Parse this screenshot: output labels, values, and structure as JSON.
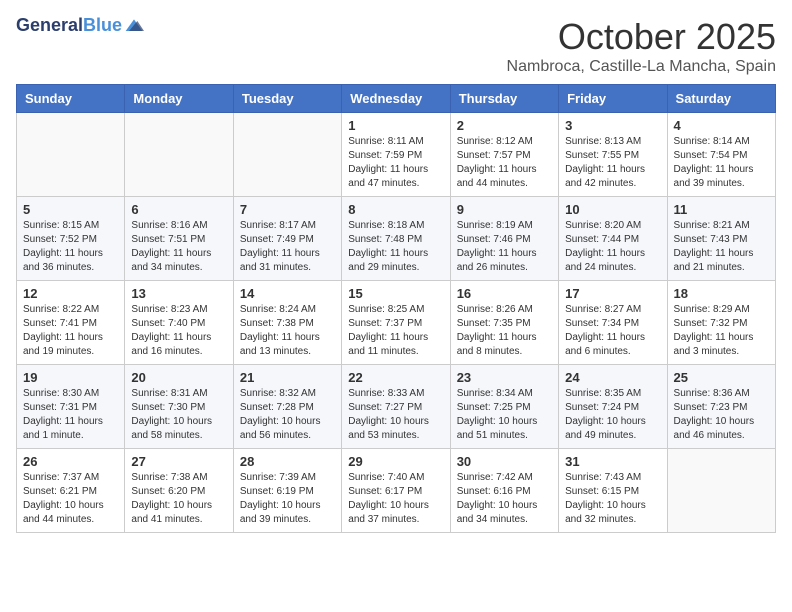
{
  "header": {
    "logo_line1": "General",
    "logo_line2": "Blue",
    "month": "October 2025",
    "location": "Nambroca, Castille-La Mancha, Spain"
  },
  "columns": [
    "Sunday",
    "Monday",
    "Tuesday",
    "Wednesday",
    "Thursday",
    "Friday",
    "Saturday"
  ],
  "weeks": [
    [
      {
        "day": "",
        "info": ""
      },
      {
        "day": "",
        "info": ""
      },
      {
        "day": "",
        "info": ""
      },
      {
        "day": "1",
        "info": "Sunrise: 8:11 AM\nSunset: 7:59 PM\nDaylight: 11 hours and 47 minutes."
      },
      {
        "day": "2",
        "info": "Sunrise: 8:12 AM\nSunset: 7:57 PM\nDaylight: 11 hours and 44 minutes."
      },
      {
        "day": "3",
        "info": "Sunrise: 8:13 AM\nSunset: 7:55 PM\nDaylight: 11 hours and 42 minutes."
      },
      {
        "day": "4",
        "info": "Sunrise: 8:14 AM\nSunset: 7:54 PM\nDaylight: 11 hours and 39 minutes."
      }
    ],
    [
      {
        "day": "5",
        "info": "Sunrise: 8:15 AM\nSunset: 7:52 PM\nDaylight: 11 hours and 36 minutes."
      },
      {
        "day": "6",
        "info": "Sunrise: 8:16 AM\nSunset: 7:51 PM\nDaylight: 11 hours and 34 minutes."
      },
      {
        "day": "7",
        "info": "Sunrise: 8:17 AM\nSunset: 7:49 PM\nDaylight: 11 hours and 31 minutes."
      },
      {
        "day": "8",
        "info": "Sunrise: 8:18 AM\nSunset: 7:48 PM\nDaylight: 11 hours and 29 minutes."
      },
      {
        "day": "9",
        "info": "Sunrise: 8:19 AM\nSunset: 7:46 PM\nDaylight: 11 hours and 26 minutes."
      },
      {
        "day": "10",
        "info": "Sunrise: 8:20 AM\nSunset: 7:44 PM\nDaylight: 11 hours and 24 minutes."
      },
      {
        "day": "11",
        "info": "Sunrise: 8:21 AM\nSunset: 7:43 PM\nDaylight: 11 hours and 21 minutes."
      }
    ],
    [
      {
        "day": "12",
        "info": "Sunrise: 8:22 AM\nSunset: 7:41 PM\nDaylight: 11 hours and 19 minutes."
      },
      {
        "day": "13",
        "info": "Sunrise: 8:23 AM\nSunset: 7:40 PM\nDaylight: 11 hours and 16 minutes."
      },
      {
        "day": "14",
        "info": "Sunrise: 8:24 AM\nSunset: 7:38 PM\nDaylight: 11 hours and 13 minutes."
      },
      {
        "day": "15",
        "info": "Sunrise: 8:25 AM\nSunset: 7:37 PM\nDaylight: 11 hours and 11 minutes."
      },
      {
        "day": "16",
        "info": "Sunrise: 8:26 AM\nSunset: 7:35 PM\nDaylight: 11 hours and 8 minutes."
      },
      {
        "day": "17",
        "info": "Sunrise: 8:27 AM\nSunset: 7:34 PM\nDaylight: 11 hours and 6 minutes."
      },
      {
        "day": "18",
        "info": "Sunrise: 8:29 AM\nSunset: 7:32 PM\nDaylight: 11 hours and 3 minutes."
      }
    ],
    [
      {
        "day": "19",
        "info": "Sunrise: 8:30 AM\nSunset: 7:31 PM\nDaylight: 11 hours and 1 minute."
      },
      {
        "day": "20",
        "info": "Sunrise: 8:31 AM\nSunset: 7:30 PM\nDaylight: 10 hours and 58 minutes."
      },
      {
        "day": "21",
        "info": "Sunrise: 8:32 AM\nSunset: 7:28 PM\nDaylight: 10 hours and 56 minutes."
      },
      {
        "day": "22",
        "info": "Sunrise: 8:33 AM\nSunset: 7:27 PM\nDaylight: 10 hours and 53 minutes."
      },
      {
        "day": "23",
        "info": "Sunrise: 8:34 AM\nSunset: 7:25 PM\nDaylight: 10 hours and 51 minutes."
      },
      {
        "day": "24",
        "info": "Sunrise: 8:35 AM\nSunset: 7:24 PM\nDaylight: 10 hours and 49 minutes."
      },
      {
        "day": "25",
        "info": "Sunrise: 8:36 AM\nSunset: 7:23 PM\nDaylight: 10 hours and 46 minutes."
      }
    ],
    [
      {
        "day": "26",
        "info": "Sunrise: 7:37 AM\nSunset: 6:21 PM\nDaylight: 10 hours and 44 minutes."
      },
      {
        "day": "27",
        "info": "Sunrise: 7:38 AM\nSunset: 6:20 PM\nDaylight: 10 hours and 41 minutes."
      },
      {
        "day": "28",
        "info": "Sunrise: 7:39 AM\nSunset: 6:19 PM\nDaylight: 10 hours and 39 minutes."
      },
      {
        "day": "29",
        "info": "Sunrise: 7:40 AM\nSunset: 6:17 PM\nDaylight: 10 hours and 37 minutes."
      },
      {
        "day": "30",
        "info": "Sunrise: 7:42 AM\nSunset: 6:16 PM\nDaylight: 10 hours and 34 minutes."
      },
      {
        "day": "31",
        "info": "Sunrise: 7:43 AM\nSunset: 6:15 PM\nDaylight: 10 hours and 32 minutes."
      },
      {
        "day": "",
        "info": ""
      }
    ]
  ]
}
